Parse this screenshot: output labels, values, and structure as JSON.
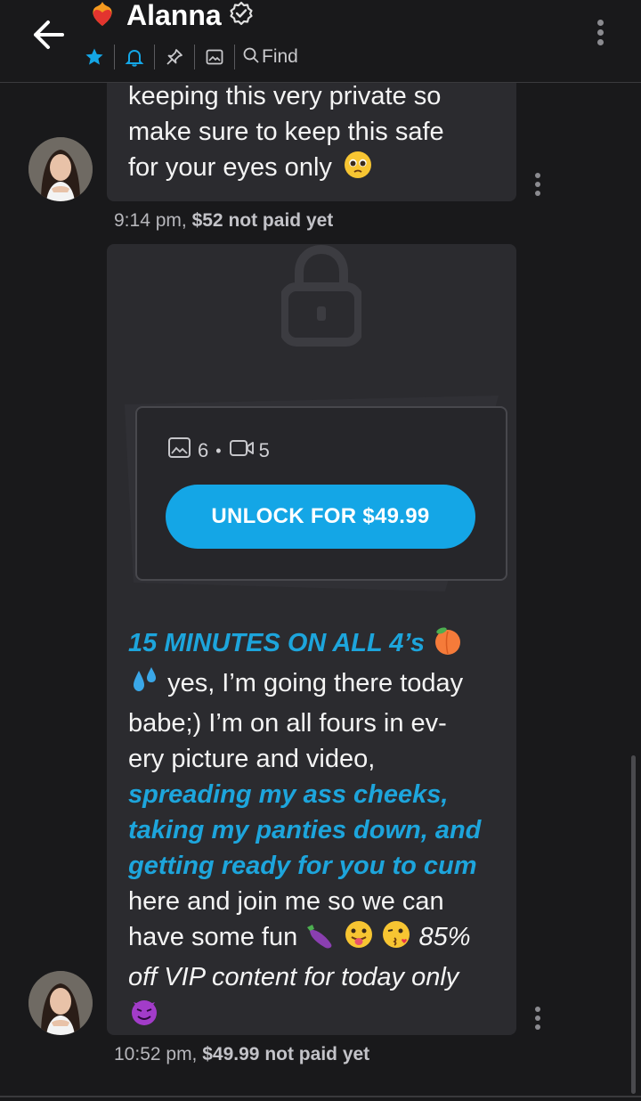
{
  "header": {
    "contact_name": "Alanna",
    "find_label": "Find",
    "icons": [
      "back-arrow-icon",
      "heart-fire-icon",
      "verified-icon",
      "star-icon",
      "bell-icon",
      "pin-icon",
      "gallery-icon",
      "search-icon",
      "more-vertical-icon"
    ]
  },
  "messages": [
    {
      "lines": [
        "keeping this very private so",
        "make sure to keep this safe",
        "for your eyes only"
      ],
      "time": "9:14 pm,",
      "price": "$52",
      "status": "not paid yet"
    },
    {
      "locked_counts": {
        "images": "6",
        "dot": "•",
        "videos": "5"
      },
      "unlock_label": "UNLOCK FOR $49.99",
      "heading": "15 MINUTES ON ALL 4’s",
      "body_1": "yes, I’m going there today",
      "body_2": "babe;) I’m on all fours in ev-",
      "body_3": "ery picture and video,",
      "blue_1": "spreading my ass cheeks,",
      "blue_2": "taking my panties down, and",
      "blue_3": "getting ready for you to cum",
      "body_4": "here and join me so we can",
      "body_5": "have some fun",
      "offer_pct": "85%",
      "offer_text": "off VIP content for today only",
      "time": "10:52 pm,",
      "price": "$49.99",
      "status": "not paid yet"
    }
  ],
  "colors": {
    "accent": "#14a6e6",
    "background": "#19191b",
    "bubble": "#2b2b2f",
    "blue_text": "#1da5dc"
  }
}
